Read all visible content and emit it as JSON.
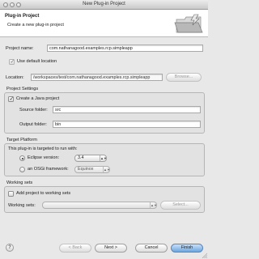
{
  "window": {
    "title": "New Plug-in Project"
  },
  "banner": {
    "title": "Plug-in Project",
    "description": "Create a new plug-in project"
  },
  "project": {
    "name_label": "Project name:",
    "name_value": "com.nathanagood.examples.rcp.simpleapp",
    "use_default_label": "Use default location",
    "use_default_checked": true,
    "location_label": "Location:",
    "location_value": "/workspaces/test/com.nathanagood.examples.rcp.simpleapp",
    "browse_label": "Browse..."
  },
  "settings": {
    "title": "Project Settings",
    "java_label": "Create a Java project",
    "java_checked": true,
    "source_label": "Source folder:",
    "source_value": "src",
    "output_label": "Output folder:",
    "output_value": "bin"
  },
  "platform": {
    "title": "Target Platform",
    "description": "This plug-in is targeted to run with:",
    "eclipse_label": "Eclipse version:",
    "eclipse_value": "3.4",
    "osgi_label": "an OSGi framework:",
    "osgi_value": "Equinox"
  },
  "working_sets": {
    "title": "Working sets",
    "add_label": "Add project to working sets",
    "sets_label": "Working sets:",
    "sets_value": "",
    "select_label": "Select..."
  },
  "footer": {
    "help_icon": "?",
    "back_label": "< Back",
    "next_label": "Next >",
    "cancel_label": "Cancel",
    "finish_label": "Finish"
  }
}
